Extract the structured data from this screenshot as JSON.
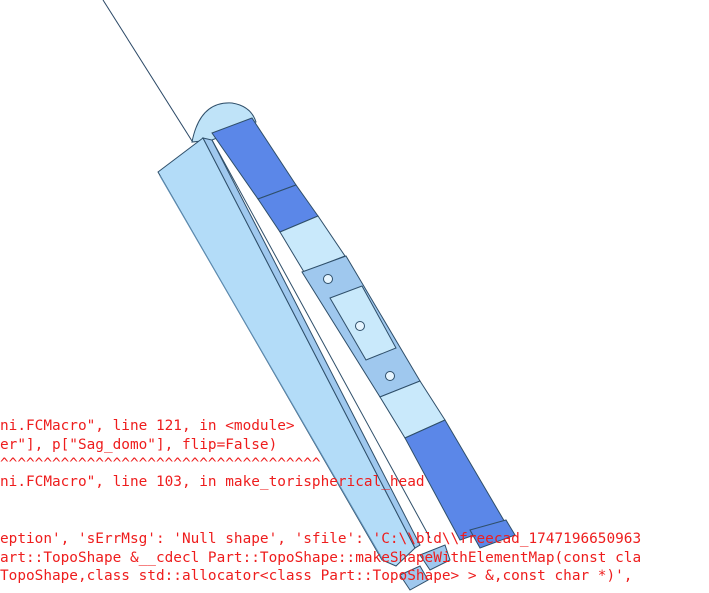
{
  "app": {
    "background": "#ffffff",
    "console_text_color": "#ee1d1d"
  },
  "scene": {
    "object": "3D vessel model (tilted) with torispherical head cap",
    "colors": {
      "light_face": "#b3dcf8",
      "mid_face": "#9fc8ee",
      "dark_face": "#5b87e8",
      "window": "#c9e9fb",
      "edge": "#2f4f6a",
      "line": "#1f3550"
    }
  },
  "console": {
    "lines": [
      "ni.FCMacro\", line 121, in <module>",
      "er\"], p[\"Sag_domo\"], flip=False)",
      "^^^^^^^^^^^^^^^^^^^^^^^^^^^^^^^^^^^^^",
      "ni.FCMacro\", line 103, in make_torispherical_head",
      "",
      "eption', 'sErrMsg': 'Null shape', 'sfile': 'C:\\\\bld\\\\freecad_1747196650963",
      "art::TopoShape &__cdecl Part::TopoShape::makeShapeWithElementMap(const cla",
      "TopoShape,class std::allocator<class Part::TopoShape> > &,const char *)',"
    ]
  }
}
